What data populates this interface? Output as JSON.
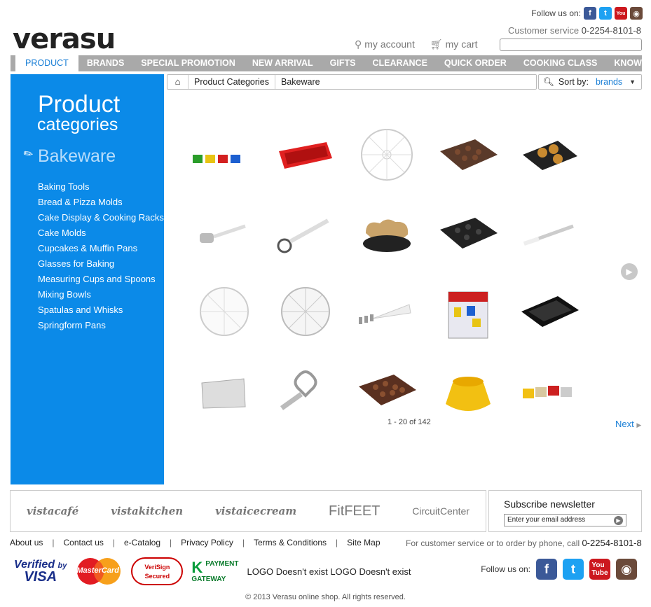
{
  "header": {
    "logo": "verasu",
    "follow_label": "Follow us on:",
    "customer_service_label": "Customer service",
    "customer_service_phone": "0-2254-8101-8",
    "my_account": "my account",
    "my_cart": "my cart",
    "search_value": ""
  },
  "nav": {
    "items": [
      "PRODUCT",
      "BRANDS",
      "SPECIAL PROMOTION",
      "NEW ARRIVAL",
      "GIFTS",
      "CLEARANCE",
      "QUICK ORDER",
      "COOKING CLASS",
      "KNOWLEDGE"
    ],
    "active": "PRODUCT"
  },
  "sidebar": {
    "title": "Product",
    "subtitle": "categories",
    "current": "Bakeware",
    "items": [
      "Baking Tools",
      "Bread & Pizza Molds",
      "Cake Display & Cooking Racks",
      "Cake Molds",
      "Cupcakes & Muffin Pans",
      "Glasses for Baking",
      "Measuring Cups and Spoons",
      "Mixing Bowls",
      "Spatulas and Whisks",
      "Springform Pans"
    ]
  },
  "breadcrumb": [
    "Product Categories",
    "Bakeware"
  ],
  "sort": {
    "label": "Sort by:",
    "value": "brands"
  },
  "products": [
    {
      "icon": "colorful-jelly-molds"
    },
    {
      "icon": "red-silicone-loaf-pan"
    },
    {
      "icon": "clear-cake-divider"
    },
    {
      "icon": "brown-chocolate-mold"
    },
    {
      "icon": "black-pop-mold"
    },
    {
      "icon": "pastry-roller"
    },
    {
      "icon": "pastry-wheel-cutter"
    },
    {
      "icon": "heart-springform-pan"
    },
    {
      "icon": "black-silicone-mold"
    },
    {
      "icon": "palette-knife"
    },
    {
      "icon": "cake-divider-round"
    },
    {
      "icon": "cake-divider-wheel"
    },
    {
      "icon": "piping-bag-set"
    },
    {
      "icon": "kids-cookie-cutters"
    },
    {
      "icon": "black-baking-tray"
    },
    {
      "icon": "decorating-comb"
    },
    {
      "icon": "heart-ring-cutter"
    },
    {
      "icon": "brown-praline-mold"
    },
    {
      "icon": "yellow-bundt-mold"
    },
    {
      "icon": "mini-cup-molds"
    }
  ],
  "pager": {
    "range": "1 - 20 of 142",
    "next": "Next"
  },
  "footer": {
    "brands": [
      "vistacafé",
      "vistakitchen",
      "vistaicecream",
      "FitFEET",
      "CircuitCenter"
    ],
    "newsletter_title": "Subscribe newsletter",
    "newsletter_placeholder": "Enter your email address",
    "links": [
      "About us",
      "Contact us",
      "e-Catalog",
      "Privacy Policy",
      "Terms & Conditions",
      "Site Map"
    ],
    "cs_text": "For customer service or to order by phone, call",
    "cs_phone": "0-2254-8101-8",
    "visa_line1": "Verified",
    "visa_line2": "by",
    "visa_line3": "VISA",
    "mastercard": "MasterCard",
    "verisign": "VeriSign Secured",
    "payment_gateway_1": "PAYMENT",
    "payment_gateway_2": "GATEWAY",
    "missing_logos": "LOGO Doesn't exist LOGO Doesn't exist",
    "follow_label": "Follow us on:",
    "copyright": "© 2013 Verasu online shop. All rights reserved."
  },
  "colors": {
    "sidebar_blue": "#0b8ae8",
    "nav_gray": "#a9a9a9",
    "link_blue": "#1a7fd6"
  }
}
